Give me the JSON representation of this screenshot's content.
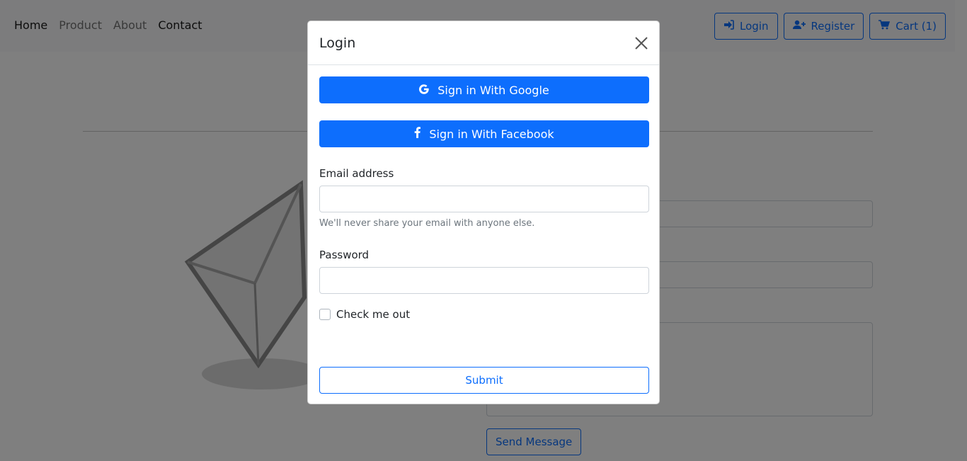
{
  "nav": {
    "links": [
      "Home",
      "Product",
      "About",
      "Contact"
    ],
    "buttons": {
      "login": "Login",
      "register": "Register",
      "cart": "Cart (1)"
    }
  },
  "background": {
    "send_button": "Send Message"
  },
  "modal": {
    "title": "Login",
    "google_button": "Sign in With Google",
    "facebook_button": "Sign in With Facebook",
    "email_label": "Email address",
    "email_value": "",
    "email_help": "We'll never share your email with anyone else.",
    "password_label": "Password",
    "password_value": "",
    "check_label": "Check me out",
    "submit_button": "Submit"
  },
  "colors": {
    "primary": "#0d6efd",
    "backdrop": "rgba(0,0,0,0.5)"
  },
  "icons": {
    "google": "google-icon",
    "facebook": "facebook-icon",
    "login": "sign-in-icon",
    "register": "user-plus-icon",
    "cart": "cart-icon",
    "close": "close-icon"
  }
}
